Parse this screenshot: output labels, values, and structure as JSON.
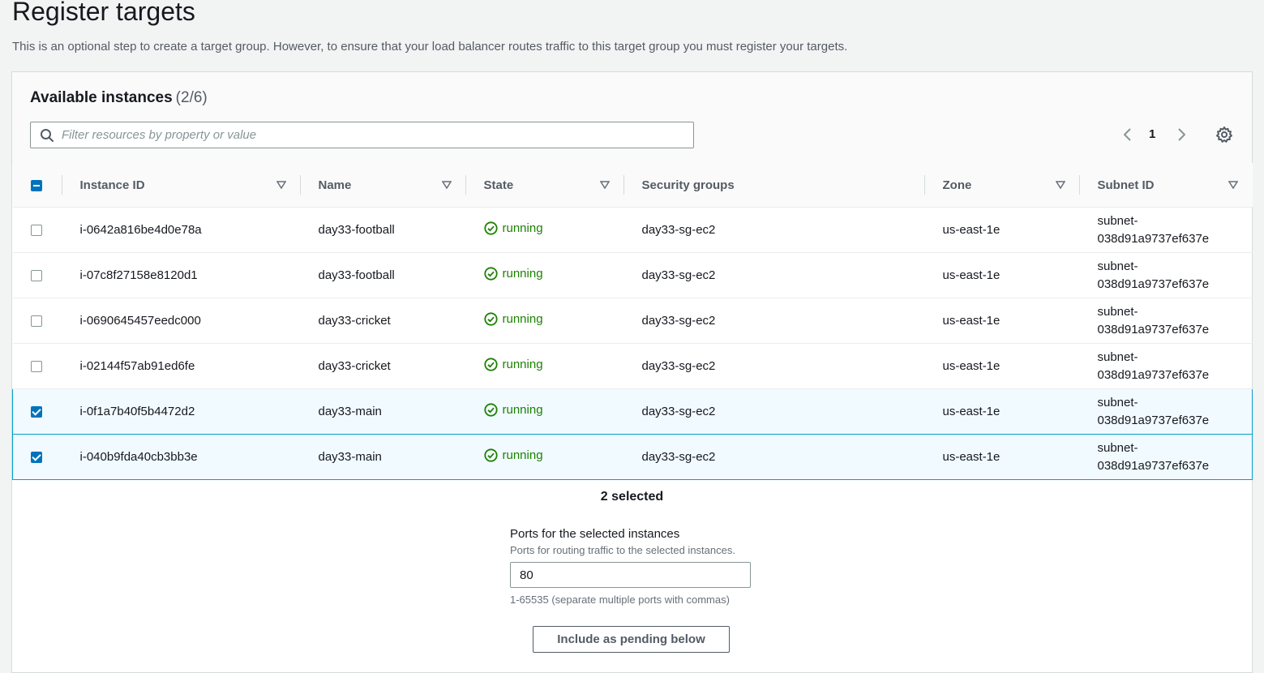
{
  "page": {
    "title": "Register targets",
    "description": "This is an optional step to create a target group. However, to ensure that your load balancer routes traffic to this target group you must register your targets."
  },
  "panel": {
    "title": "Available instances",
    "count": "(2/6)",
    "search_placeholder": "Filter resources by property or value",
    "search_value": "",
    "page_number": "1"
  },
  "table": {
    "columns": [
      "Instance ID",
      "Name",
      "State",
      "Security groups",
      "Zone",
      "Subnet ID"
    ],
    "rows": [
      {
        "selected": false,
        "instance_id": "i-0642a816be4d0e78a",
        "name": "day33-football",
        "state": "running",
        "security_groups": "day33-sg-ec2",
        "zone": "us-east-1e",
        "subnet_line1": "subnet-",
        "subnet_line2": "038d91a9737ef637e"
      },
      {
        "selected": false,
        "instance_id": "i-07c8f27158e8120d1",
        "name": "day33-football",
        "state": "running",
        "security_groups": "day33-sg-ec2",
        "zone": "us-east-1e",
        "subnet_line1": "subnet-",
        "subnet_line2": "038d91a9737ef637e"
      },
      {
        "selected": false,
        "instance_id": "i-0690645457eedc000",
        "name": "day33-cricket",
        "state": "running",
        "security_groups": "day33-sg-ec2",
        "zone": "us-east-1e",
        "subnet_line1": "subnet-",
        "subnet_line2": "038d91a9737ef637e"
      },
      {
        "selected": false,
        "instance_id": "i-02144f57ab91ed6fe",
        "name": "day33-cricket",
        "state": "running",
        "security_groups": "day33-sg-ec2",
        "zone": "us-east-1e",
        "subnet_line1": "subnet-",
        "subnet_line2": "038d91a9737ef637e"
      },
      {
        "selected": true,
        "instance_id": "i-0f1a7b40f5b4472d2",
        "name": "day33-main",
        "state": "running",
        "security_groups": "day33-sg-ec2",
        "zone": "us-east-1e",
        "subnet_line1": "subnet-",
        "subnet_line2": "038d91a9737ef637e"
      },
      {
        "selected": true,
        "instance_id": "i-040b9fda40cb3bb3e",
        "name": "day33-main",
        "state": "running",
        "security_groups": "day33-sg-ec2",
        "zone": "us-east-1e",
        "subnet_line1": "subnet-",
        "subnet_line2": "038d91a9737ef637e"
      }
    ]
  },
  "footer": {
    "selected_text": "2 selected",
    "ports_label": "Ports for the selected instances",
    "ports_description": "Ports for routing traffic to the selected instances.",
    "ports_value": "80",
    "ports_constraint": "1-65535 (separate multiple ports with commas)",
    "pending_button_label": "Include as pending below"
  },
  "colors": {
    "accent": "#0073bb",
    "running": "#1d8102",
    "selected_row_bg": "#f1faff",
    "selected_row_border": "#00a1c9"
  },
  "icons": {
    "search": "search-icon",
    "prev": "chevron-left-icon",
    "next": "chevron-right-icon",
    "settings": "gear-icon",
    "sort": "caret-down-icon",
    "status": "check-circle-icon"
  }
}
